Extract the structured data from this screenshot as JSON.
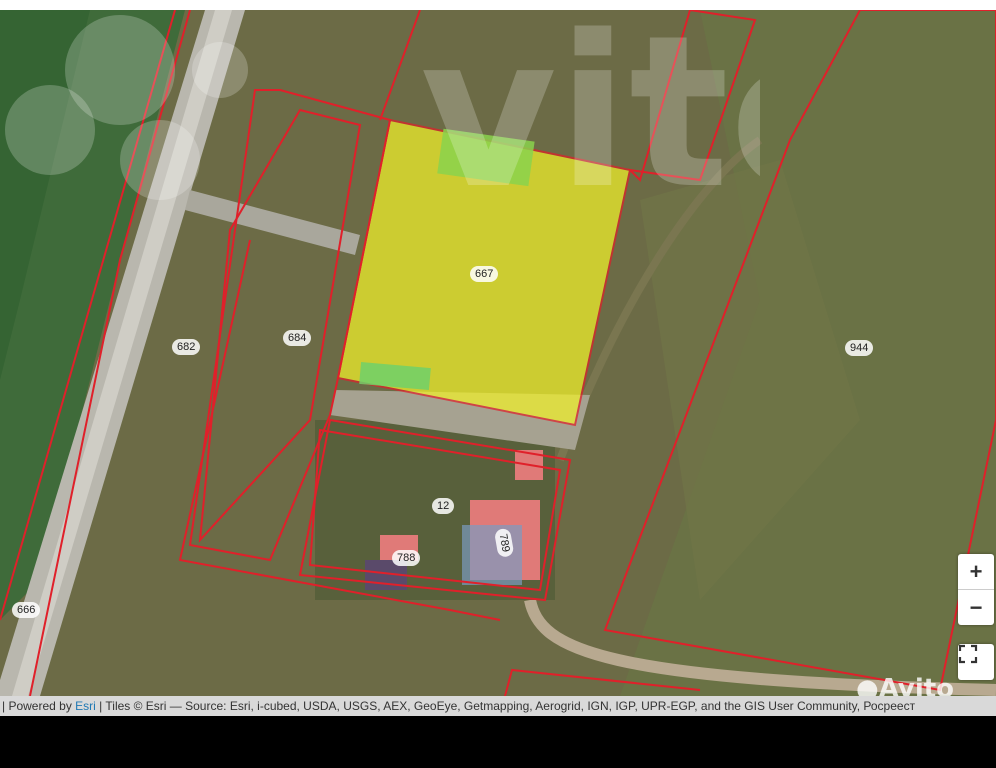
{
  "map": {
    "plots": [
      {
        "label": "667",
        "highlighted": true
      },
      {
        "label": "684"
      },
      {
        "label": "682"
      },
      {
        "label": "944"
      },
      {
        "label": "12"
      },
      {
        "label": "789"
      },
      {
        "label": "788"
      },
      {
        "label": "666"
      }
    ],
    "colors": {
      "boundary": "#e0202a",
      "highlight": "#f2f22a",
      "field": "#6d6b45"
    }
  },
  "controls": {
    "zoom_in": "+",
    "zoom_out": "−",
    "fullscreen_icon": "fullscreen-icon"
  },
  "attribution": {
    "prefix": "| Powered by ",
    "esri": "Esri",
    "rest": " | Tiles © Esri — Source: Esri, i-cubed, USDA, USGS, AEX, GeoEye, Getmapping, Aerogrid, IGN, IGP, UPR-EGP, and the GIS User Community, Росреест"
  },
  "watermark": {
    "text": "Avito"
  }
}
